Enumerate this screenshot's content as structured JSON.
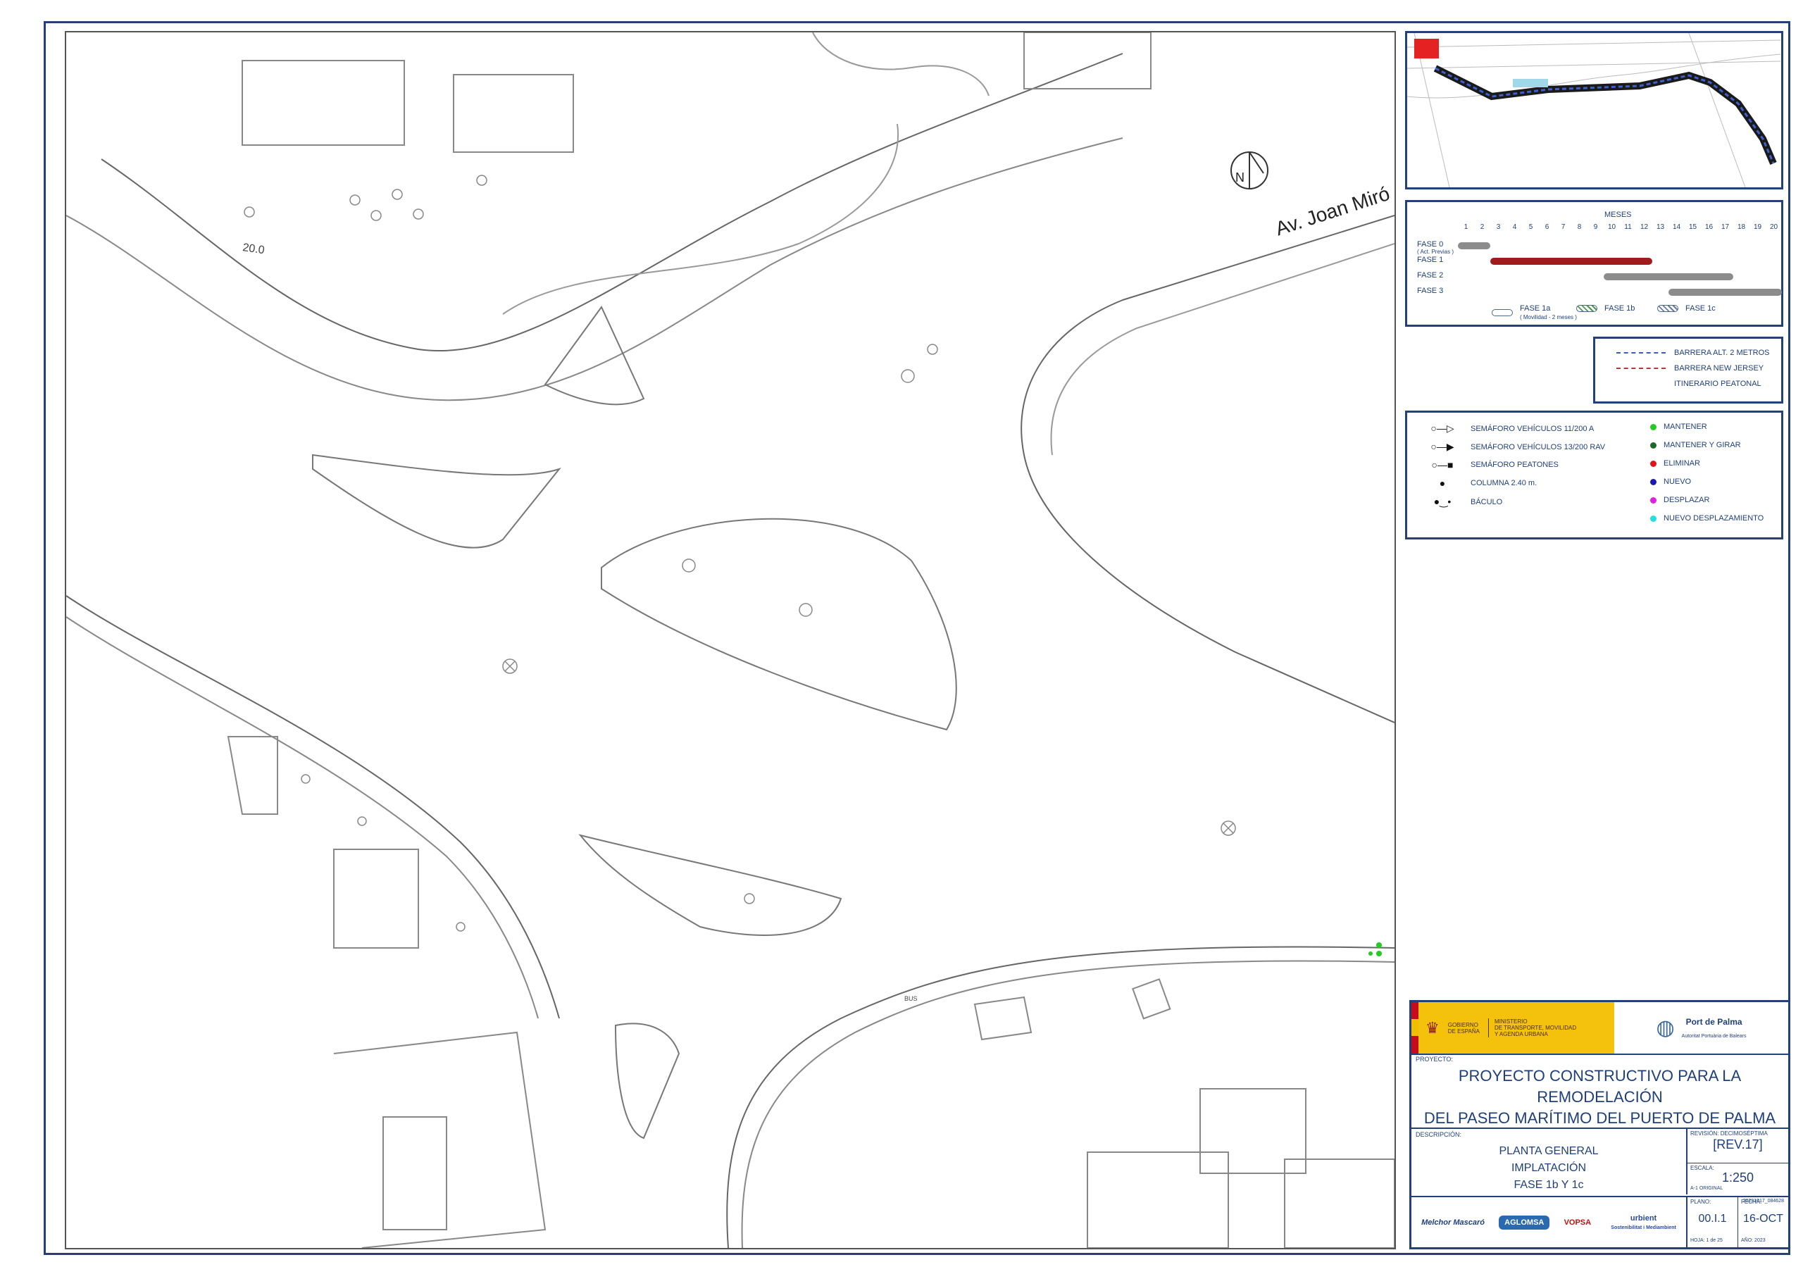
{
  "map": {
    "street_label": "Av. Joan Miró",
    "contour_label": "20.0",
    "north_label": "N",
    "bus_label": "BUS"
  },
  "gantt": {
    "title": "MESES",
    "months": [
      "1",
      "2",
      "3",
      "4",
      "5",
      "6",
      "7",
      "8",
      "9",
      "10",
      "11",
      "12",
      "13",
      "14",
      "15",
      "16",
      "17",
      "18",
      "19",
      "20"
    ],
    "rows": [
      {
        "label": "FASE 0",
        "sub": "( Act. Previas )",
        "start": 1,
        "end": 2,
        "color": "#8c8c8c"
      },
      {
        "label": "FASE 1",
        "sub": "",
        "start": 3,
        "end": 12,
        "color": "#a01c1c"
      },
      {
        "label": "FASE 2",
        "sub": "",
        "start": 10,
        "end": 17,
        "color": "#8c8c8c"
      },
      {
        "label": "FASE 3",
        "sub": "",
        "start": 14,
        "end": 20,
        "color": "#8c8c8c"
      }
    ],
    "keys": [
      {
        "label": "FASE 1a",
        "sub": "( Movilidad - 2 meses )"
      },
      {
        "label": "FASE 1b",
        "sub": ""
      },
      {
        "label": "FASE 1c",
        "sub": ""
      }
    ]
  },
  "barriers": [
    {
      "label": "BARRERA ALT. 2 METROS",
      "color": "#3a5fb0"
    },
    {
      "label": "BARRERA NEW JERSEY",
      "color": "#b03a3a"
    },
    {
      "label": "ITINERARIO PEATONAL",
      "color": ""
    }
  ],
  "legend": {
    "symbols": [
      {
        "label": "SEMÁFORO VEHÍCULOS 11/200 A",
        "glyph": "○—▷"
      },
      {
        "label": "SEMÁFORO VEHÍCULOS 13/200 RAV",
        "glyph": "○—▶"
      },
      {
        "label": "SEMÁFORO PEATONES",
        "glyph": "○—■"
      },
      {
        "label": "COLUMNA 2.40 m.",
        "glyph": "●"
      },
      {
        "label": "BÁCULO",
        "glyph": "●‿•"
      }
    ],
    "status": [
      {
        "label": "MANTENER",
        "color": "#22cc22"
      },
      {
        "label": "MANTENER Y GIRAR",
        "color": "#1a6b2a"
      },
      {
        "label": "ELIMINAR",
        "color": "#e01515"
      },
      {
        "label": "NUEVO",
        "color": "#1a1ab0"
      },
      {
        "label": "DESPLAZAR",
        "color": "#e020e0"
      },
      {
        "label": "NUEVO DESPLAZAMIENTO",
        "color": "#20e0e0"
      }
    ]
  },
  "title_block": {
    "gov": {
      "line1": "GOBIERNO",
      "line2": "DE ESPAÑA",
      "ministry1": "MINISTERIO",
      "ministry2": "DE TRANSPORTE, MOVILIDAD",
      "ministry3": "Y AGENDA URBANA"
    },
    "port": {
      "name": "Port de Palma",
      "sub": "Autoritat Portuària de Balears"
    },
    "project_label": "PROYECTO:",
    "project_line1": "PROYECTO CONSTRUCTIVO PARA LA REMODELACIÓN",
    "project_line2": "DEL PASEO MARÍTIMO DEL PUERTO DE PALMA",
    "description_label": "DESCRIPCIÓN:",
    "description_line1": "PLANTA GENERAL",
    "description_line2": "IMPLATACIÓN",
    "description_line3": "FASE 1b Y 1c",
    "revision_label": "REVISIÓN:",
    "revision_word": "DECIMOSÉPTIMA",
    "revision_value": "[REV.17]",
    "scale_label": "ESCALA:",
    "scale_value": "1:250",
    "scale_note": "A-1 ORIGINAL",
    "file_code": "20231017_084628",
    "plano_label": "PLANO:",
    "plano_value": "00.I.1",
    "hoja": "HOJA: 1 de 25",
    "fecha_label": "FECHA:",
    "fecha_value": "16-OCT",
    "anio": "AÑO: 2023",
    "logos": [
      "Melchor Mascaró",
      "AGLOMSA",
      "VOPSA",
      "urbient"
    ],
    "urbient_sub": "Sostenibilitat i Mediambient"
  }
}
